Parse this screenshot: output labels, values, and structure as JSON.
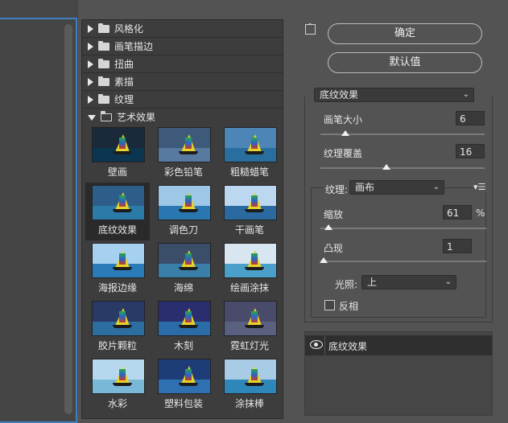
{
  "filter_categories": [
    {
      "label": "风格化",
      "expanded": false
    },
    {
      "label": "画笔描边",
      "expanded": false
    },
    {
      "label": "扭曲",
      "expanded": false
    },
    {
      "label": "素描",
      "expanded": false
    },
    {
      "label": "纹理",
      "expanded": false
    },
    {
      "label": "艺术效果",
      "expanded": true
    }
  ],
  "artistic_filters": [
    {
      "label": "壁画",
      "selected": false
    },
    {
      "label": "彩色铅笔",
      "selected": false
    },
    {
      "label": "粗糙蜡笔",
      "selected": false
    },
    {
      "label": "底纹效果",
      "selected": true
    },
    {
      "label": "调色刀",
      "selected": false
    },
    {
      "label": "干画笔",
      "selected": false
    },
    {
      "label": "海报边缘",
      "selected": false
    },
    {
      "label": "海绵",
      "selected": false
    },
    {
      "label": "绘画涂抹",
      "selected": false
    },
    {
      "label": "胶片颗粒",
      "selected": false
    },
    {
      "label": "木刻",
      "selected": false
    },
    {
      "label": "霓虹灯光",
      "selected": false
    },
    {
      "label": "水彩",
      "selected": false
    },
    {
      "label": "塑料包装",
      "selected": false
    },
    {
      "label": "涂抹棒",
      "selected": false
    }
  ],
  "buttons": {
    "ok": "确定",
    "default": "默认值"
  },
  "filter_select": {
    "value": "底纹效果"
  },
  "settings": {
    "brush_size": {
      "label": "画笔大小",
      "value": "6",
      "level": 0.15
    },
    "texture_coverage": {
      "label": "纹理覆盖",
      "value": "16",
      "level": 0.4
    },
    "texture": {
      "label": "纹理:",
      "value": "画布"
    },
    "scaling": {
      "label": "缩放",
      "value": "61",
      "unit": "%",
      "level": 0.05
    },
    "relief": {
      "label": "凸现",
      "value": "1",
      "level": 0.02
    },
    "light": {
      "label": "光照:",
      "value": "上"
    },
    "invert": {
      "label": "反相",
      "checked": false
    }
  },
  "layers": [
    {
      "label": "底纹效果",
      "visible": true
    }
  ],
  "colors": {
    "accent_blue": "#3f7fbf",
    "panel_bg": "#535353",
    "list_bg": "#3d3d3d"
  }
}
